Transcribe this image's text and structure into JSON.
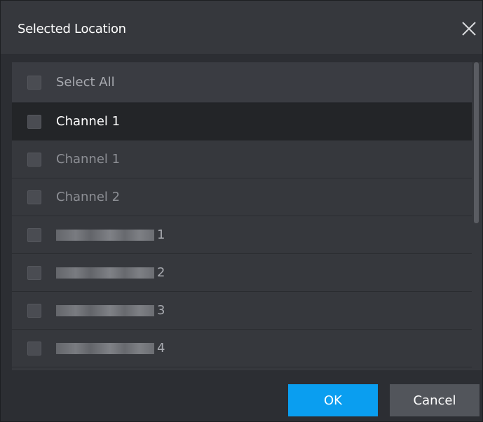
{
  "dialog": {
    "title": "Selected Location",
    "close_icon": "close-icon"
  },
  "list": {
    "select_all_label": "Select All",
    "items": [
      {
        "label": "Channel 1",
        "checked": false,
        "selected": true
      },
      {
        "label": "Channel 1",
        "checked": false,
        "selected": false
      },
      {
        "label": "Channel 2",
        "checked": false,
        "selected": false
      },
      {
        "label": "1",
        "checked": false,
        "selected": false,
        "obscured": true
      },
      {
        "label": "2",
        "checked": false,
        "selected": false,
        "obscured": true
      },
      {
        "label": "3",
        "checked": false,
        "selected": false,
        "obscured": true
      },
      {
        "label": "4",
        "checked": false,
        "selected": false,
        "obscured": true
      }
    ]
  },
  "footer": {
    "ok_label": "OK",
    "cancel_label": "Cancel"
  },
  "colors": {
    "accent": "#0a9ef0",
    "background": "#2c2e33",
    "panel": "#36383d",
    "selected_row": "#232528"
  }
}
